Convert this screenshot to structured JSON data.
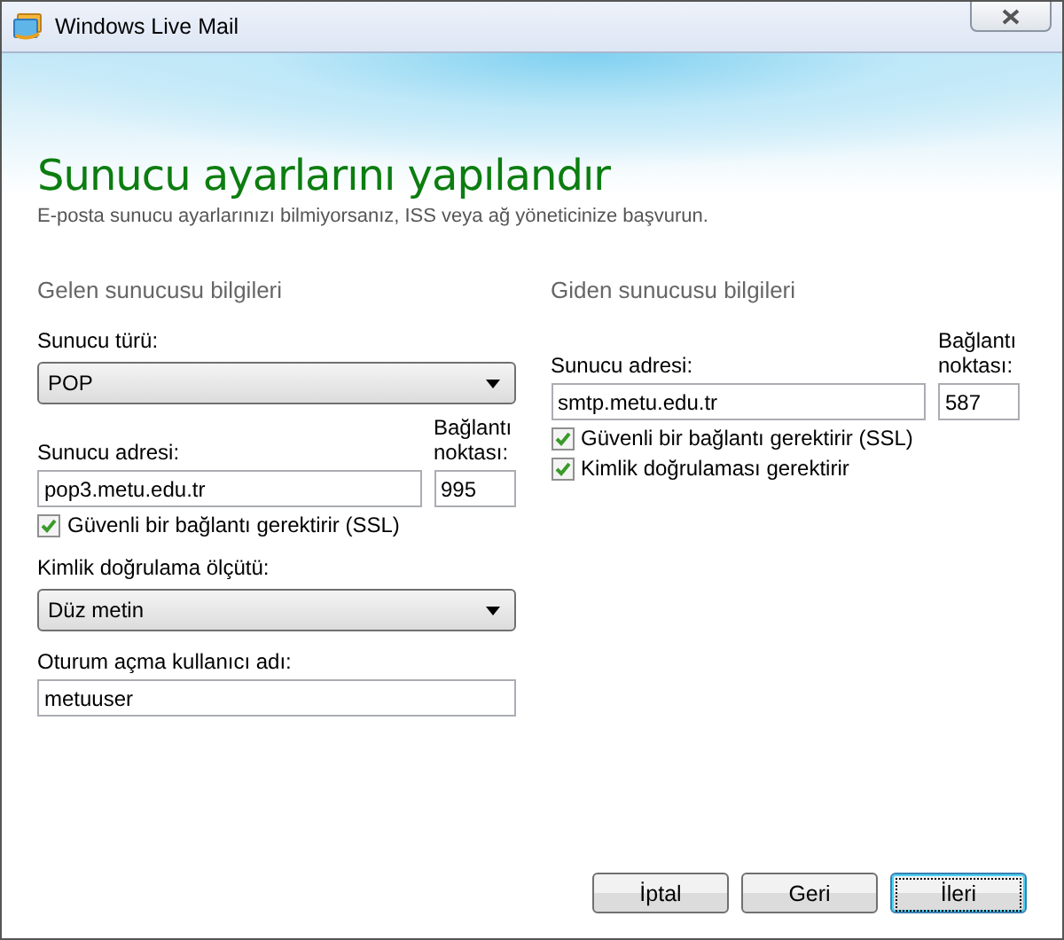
{
  "window": {
    "title": "Windows Live Mail"
  },
  "heading": "Sunucu ayarlarını yapılandır",
  "subtitle": "E-posta sunucu ayarlarınızı bilmiyorsanız, ISS veya ağ yöneticinize başvurun.",
  "incoming": {
    "section_title": "Gelen sunucusu bilgileri",
    "server_type": {
      "label": "Sunucu türü:",
      "value": "POP"
    },
    "server_address": {
      "label": "Sunucu adresi:",
      "value": "pop3.metu.edu.tr"
    },
    "port": {
      "label": "Bağlantı noktası:",
      "value": "995"
    },
    "checkboxes": [
      {
        "label": "Güvenli bir bağlantı gerektirir (SSL)",
        "checked": true
      }
    ],
    "auth_method": {
      "label": "Kimlik doğrulama ölçütü:",
      "value": "Düz metin"
    },
    "login_name": {
      "label": "Oturum açma kullanıcı adı:",
      "value": "metuuser"
    }
  },
  "outgoing": {
    "section_title": "Giden sunucusu bilgileri",
    "server_address": {
      "label": "Sunucu adresi:",
      "value": "smtp.metu.edu.tr"
    },
    "port": {
      "label": "Bağlantı noktası:",
      "value": "587"
    },
    "checkboxes": [
      {
        "label": "Güvenli bir bağlantı gerektirir (SSL)",
        "checked": true
      },
      {
        "label": "Kimlik doğrulaması gerektirir",
        "checked": true
      }
    ]
  },
  "buttons": [
    {
      "label": "İptal",
      "focused": false
    },
    {
      "label": "Geri",
      "focused": false
    },
    {
      "label": "İleri",
      "focused": true
    }
  ]
}
